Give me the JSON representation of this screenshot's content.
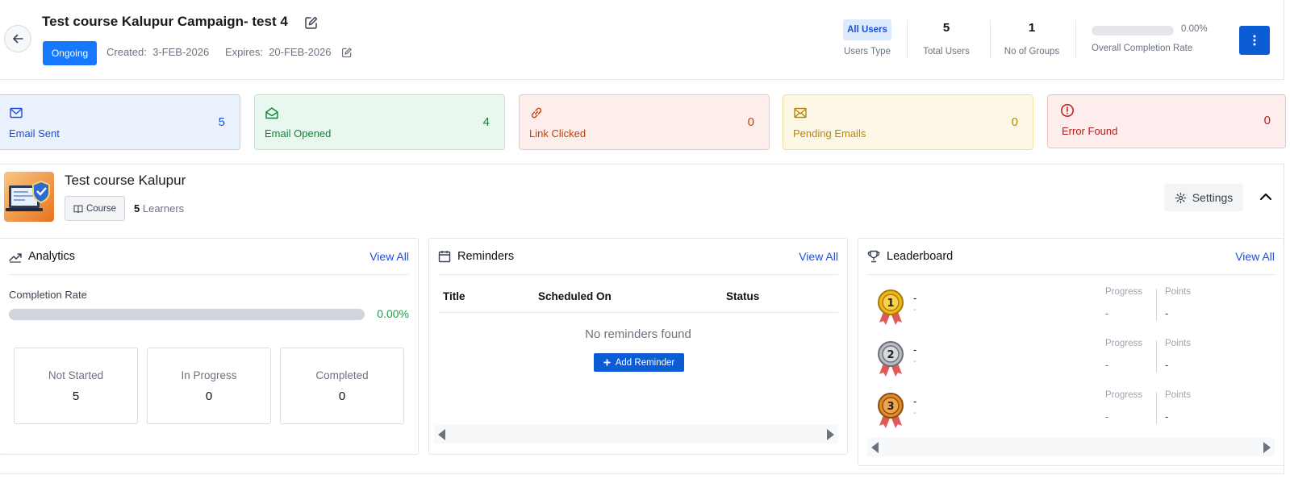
{
  "header": {
    "title": "Test course Kalupur Campaign- test 4",
    "status": "Ongoing",
    "created_label": "Created:",
    "created_date": "3-FEB-2026",
    "expires_label": "Expires:",
    "expires_date": "20-FEB-2026",
    "users_type_value": "All Users",
    "users_type_label": "Users Type",
    "total_users_value": "5",
    "total_users_label": "Total Users",
    "groups_value": "1",
    "groups_label": "No of Groups",
    "completion_pct": "0.00%",
    "completion_fraction": 0,
    "completion_label": "Overall Completion Rate"
  },
  "metrics": [
    {
      "label": "Email Sent",
      "value": "5",
      "icon": "mail-icon"
    },
    {
      "label": "Email Opened",
      "value": "4",
      "icon": "mail-open-icon"
    },
    {
      "label": "Link Clicked",
      "value": "0",
      "icon": "link-icon"
    },
    {
      "label": "Pending Emails",
      "value": "0",
      "icon": "mail-pending-icon"
    },
    {
      "label": "Error Found",
      "value": "0",
      "icon": "alert-circle-icon"
    }
  ],
  "course": {
    "title": "Test course Kalupur",
    "tag": "Course",
    "learners_count": "5",
    "learners_label": "Learners",
    "settings_label": "Settings"
  },
  "analytics": {
    "title": "Analytics",
    "view_all": "View All",
    "completion_label": "Completion Rate",
    "completion_pct": "0.00%",
    "completion_fraction": 0,
    "stats": [
      {
        "label": "Not Started",
        "value": "5"
      },
      {
        "label": "In Progress",
        "value": "0"
      },
      {
        "label": "Completed",
        "value": "0"
      }
    ]
  },
  "reminders": {
    "title": "Reminders",
    "view_all": "View All",
    "columns": [
      "Title",
      "Scheduled On",
      "Status"
    ],
    "empty_text": "No reminders found",
    "add_label": "Add Reminder"
  },
  "leaderboard": {
    "title": "Leaderboard",
    "view_all": "View All",
    "progress_label": "Progress",
    "points_label": "Points",
    "rows": [
      {
        "rank": "1",
        "name": "-",
        "sub": "-",
        "progress": "-",
        "points": "-"
      },
      {
        "rank": "2",
        "name": "-",
        "sub": "-",
        "progress": "-",
        "points": "-"
      },
      {
        "rank": "3",
        "name": "-",
        "sub": "-",
        "progress": "-",
        "points": "-"
      }
    ]
  },
  "colors": {
    "primary": "#1677ff",
    "primary_dark": "#0b5cd5",
    "success": "#16a34a"
  }
}
